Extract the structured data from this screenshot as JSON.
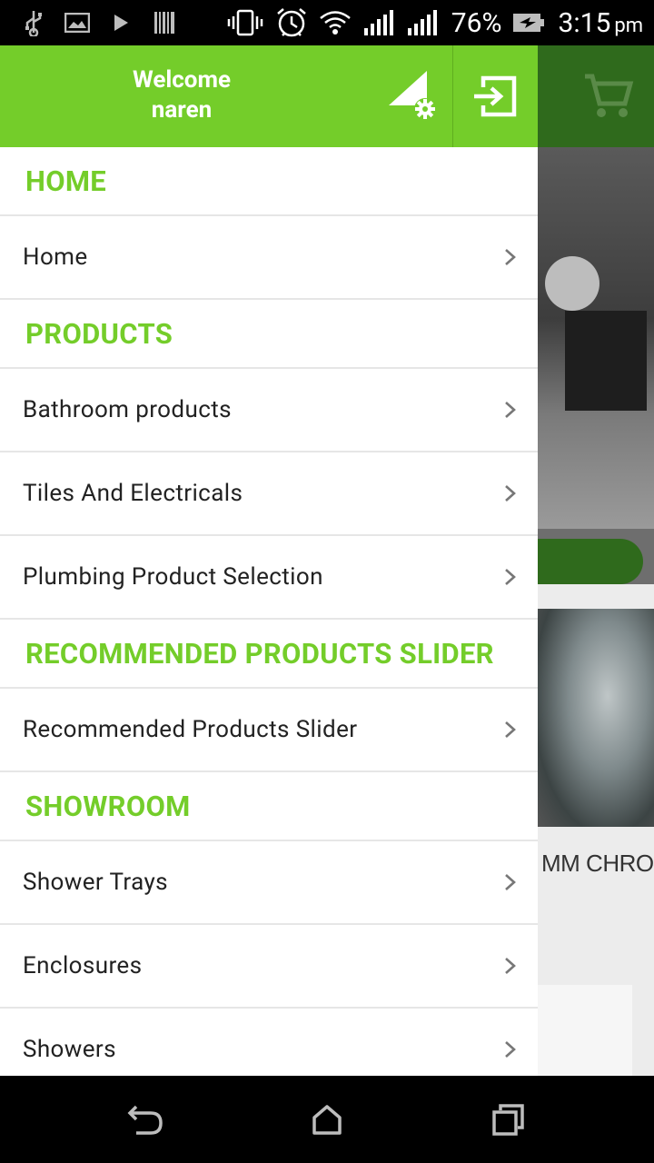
{
  "status_bar": {
    "battery_percent": "76%",
    "time": "3:15",
    "time_suffix": "pm",
    "icons": [
      "usb-icon",
      "image-icon",
      "play-icon",
      "barcode-icon",
      "vibrate-icon",
      "alarm-icon",
      "wifi-icon",
      "signal-icon",
      "signal-icon",
      "battery-icon"
    ]
  },
  "drawer": {
    "welcome_line1": "Welcome",
    "welcome_line2": "naren",
    "accent_color": "#74cd2a",
    "sections": [
      {
        "label": "HOME",
        "items": [
          {
            "label": "Home"
          }
        ]
      },
      {
        "label": "PRODUCTS",
        "items": [
          {
            "label": "Bathroom products"
          },
          {
            "label": "Tiles And Electricals"
          },
          {
            "label": "Plumbing Product Selection"
          }
        ]
      },
      {
        "label": "RECOMMENDED PRODUCTS SLIDER",
        "items": [
          {
            "label": "Recommended Products Slider"
          }
        ]
      },
      {
        "label": "SHOWROOM",
        "items": [
          {
            "label": "Shower Trays"
          },
          {
            "label": "Enclosures"
          },
          {
            "label": "Showers"
          }
        ]
      }
    ]
  },
  "background_app": {
    "product_text_fragment": "MM CHROM"
  },
  "nav_bar": {
    "icons": [
      "back-icon",
      "home-icon",
      "recents-icon"
    ]
  }
}
